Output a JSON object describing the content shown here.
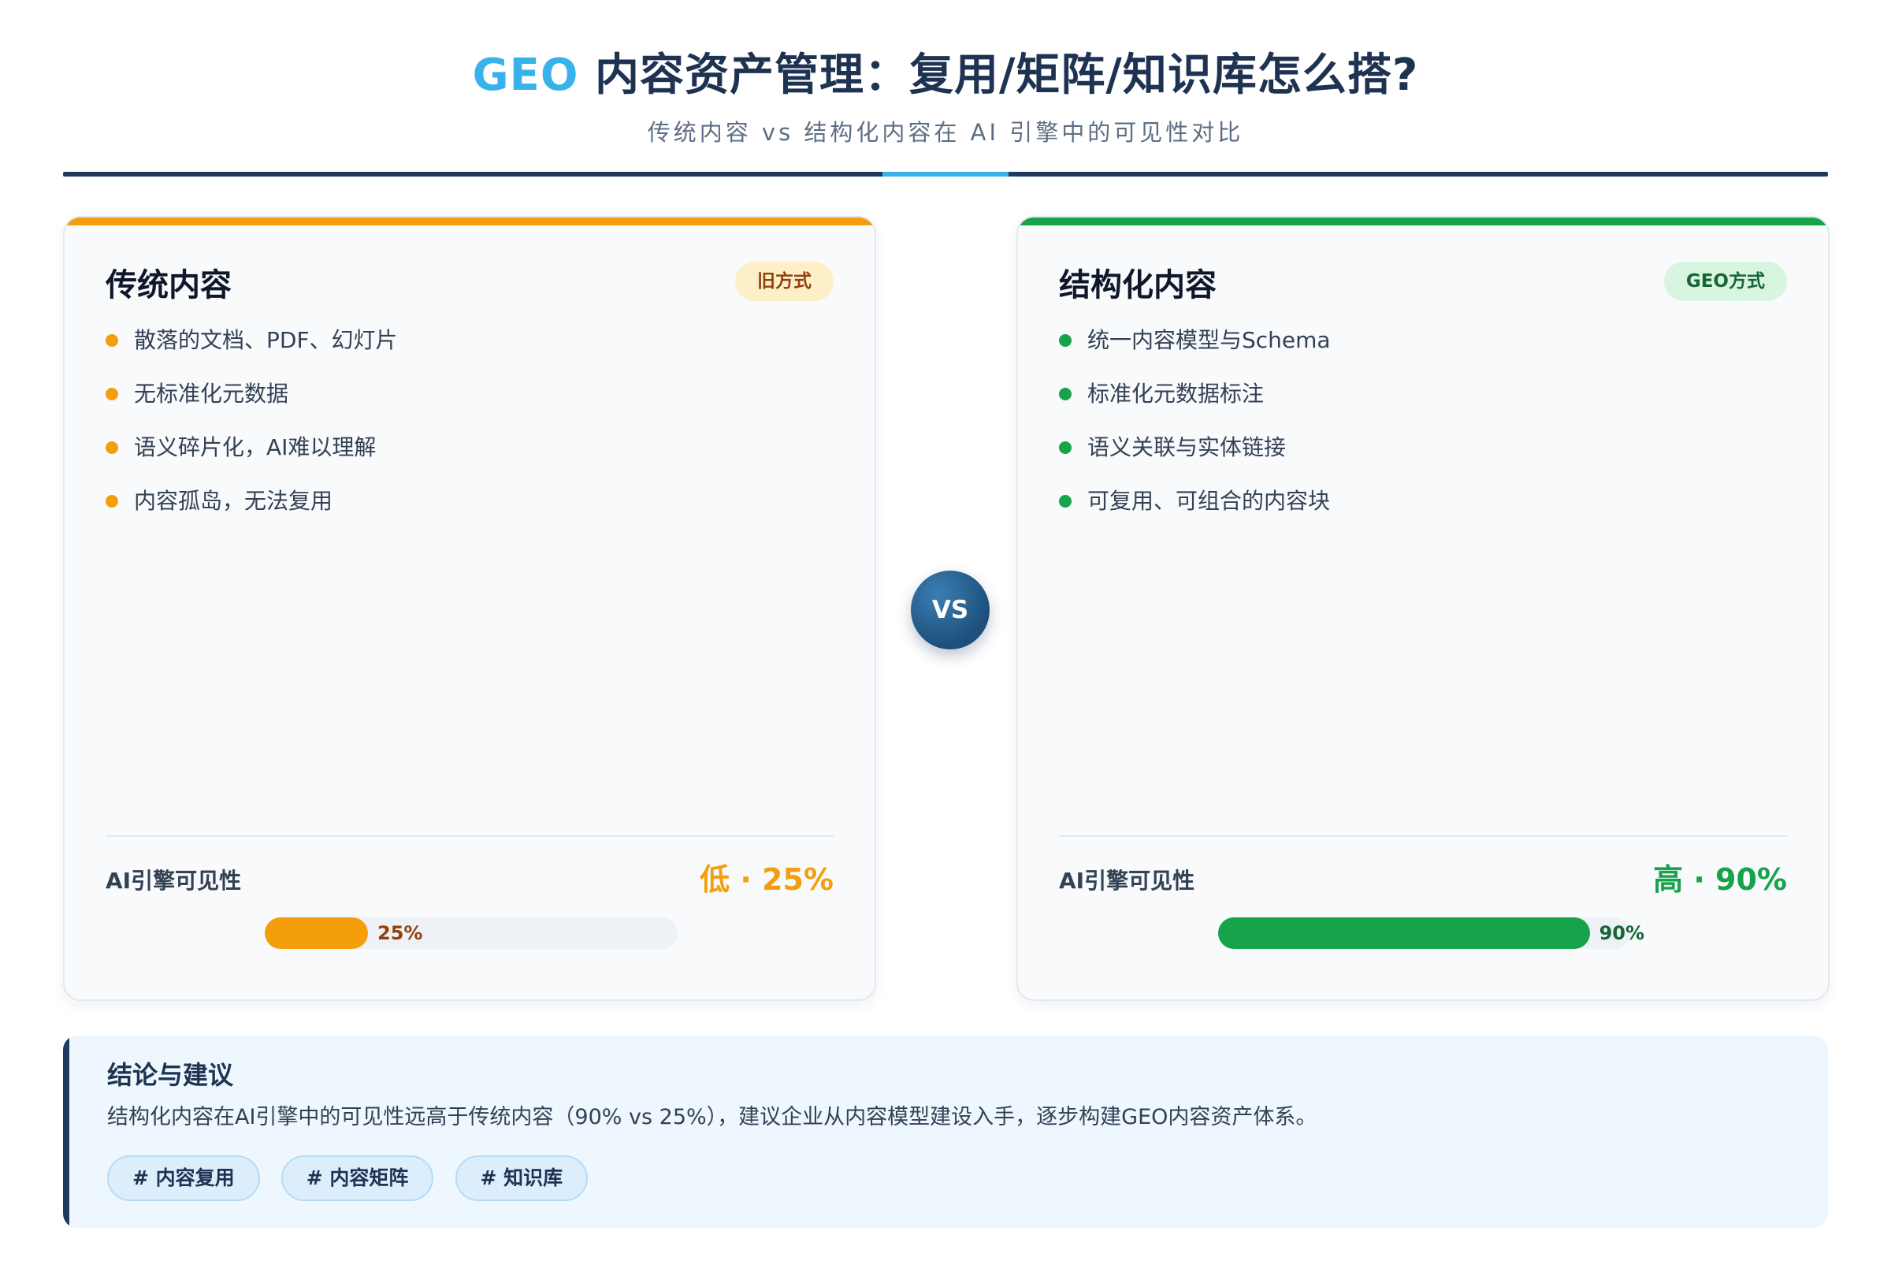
{
  "header": {
    "title_accent": "GEO",
    "title_rest": " 内容资产管理：复用/矩阵/知识库怎么搭?",
    "subtitle": "传统内容 vs 结构化内容在 AI 引擎中的可见性对比"
  },
  "left_card": {
    "title": "传统内容",
    "badge": "旧方式",
    "items": [
      "散落的文档、PDF、幻灯片",
      "无标准化元数据",
      "语义碎片化，AI难以理解",
      "内容孤岛，无法复用"
    ],
    "visibility_label": "AI引擎可见性",
    "visibility_value": "低 · 25%",
    "progress": 0.25,
    "progress_label": "25%",
    "accent_color": "#f59e0b"
  },
  "vs_label": "VS",
  "right_card": {
    "title": "结构化内容",
    "badge": "GEO方式",
    "items": [
      "统一内容模型与Schema",
      "标准化元数据标注",
      "语义关联与实体链接",
      "可复用、可组合的内容块"
    ],
    "visibility_label": "AI引擎可见性",
    "visibility_value": "高 · 90%",
    "progress": 0.9,
    "progress_label": "90%",
    "accent_color": "#16a34a"
  },
  "conclusion": {
    "title": "结论与建议",
    "body": "结构化内容在AI引擎中的可见性远高于传统内容（90% vs 25%），建议企业从内容模型建设入手，逐步构建GEO内容资产体系。",
    "tags": [
      "# 内容复用",
      "# 内容矩阵",
      "# 知识库"
    ]
  }
}
